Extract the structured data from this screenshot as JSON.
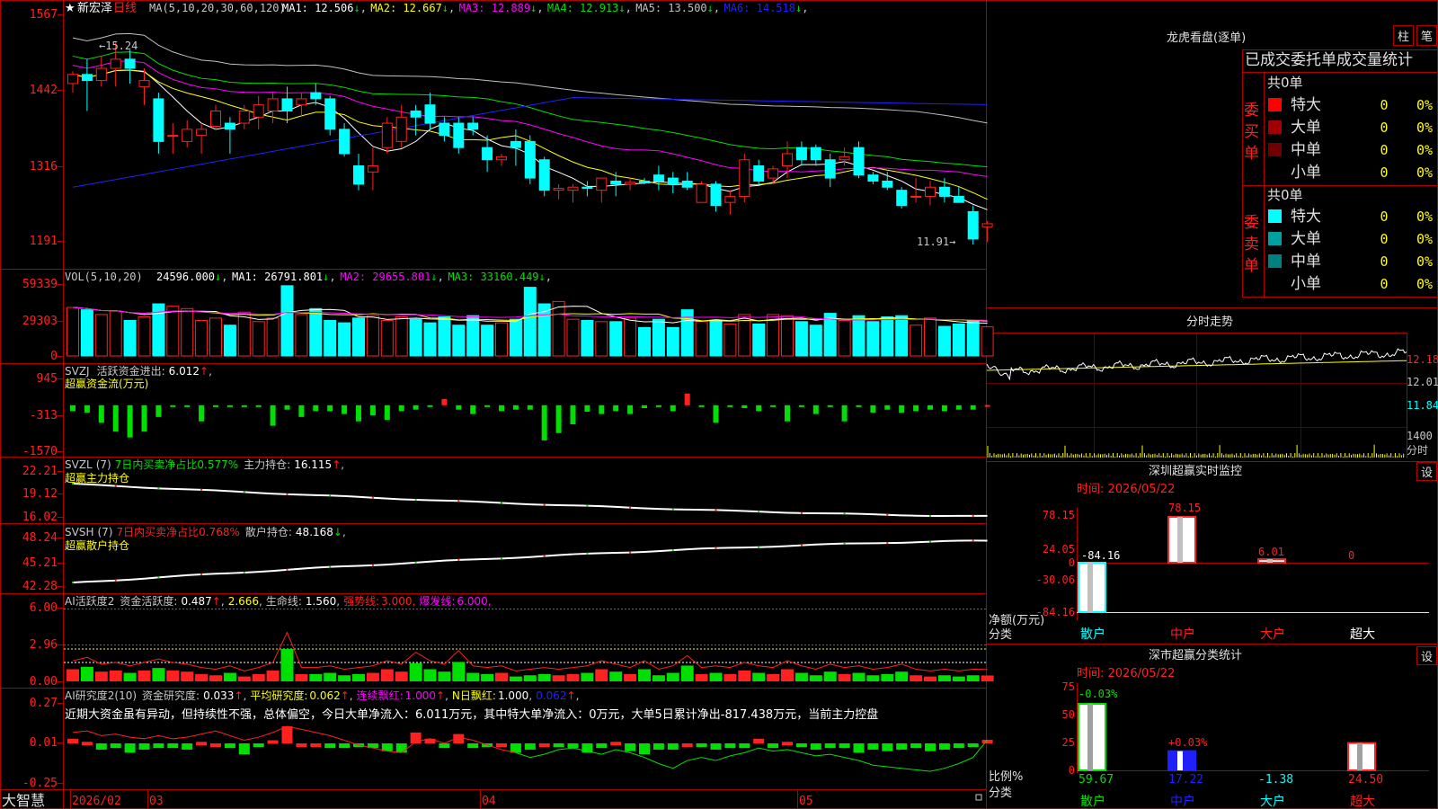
{
  "app": {
    "name": "大智慧"
  },
  "stock": {
    "star": "★",
    "name": "新宏泽",
    "period": "日线"
  },
  "kline": {
    "ma_title": "MA(5,10,20,30,60,120)",
    "ma": [
      {
        "label": "MA1:",
        "value": "12.506",
        "arrow": "↓",
        "color": "#ffffff"
      },
      {
        "label": "MA2:",
        "value": "12.667",
        "arrow": "↓",
        "color": "#ffff00"
      },
      {
        "label": "MA3:",
        "value": "12.889",
        "arrow": "↓",
        "color": "#ff00ff"
      },
      {
        "label": "MA4:",
        "value": "12.913",
        "arrow": "↓",
        "color": "#00e000"
      },
      {
        "label": "MA5:",
        "value": "13.500",
        "arrow": "↓",
        "color": "#c0c0c0"
      },
      {
        "label": "MA6:",
        "value": "14.518",
        "arrow": "↓",
        "color": "#2020ff"
      }
    ],
    "y_ticks": [
      "1567",
      "1442",
      "1316",
      "1191"
    ],
    "y_range": [
      11.91,
      15.67
    ],
    "high_label": "←15.24",
    "low_label": "11.91→",
    "candles": [
      [
        14.55,
        14.75,
        14.4,
        14.7
      ],
      [
        14.7,
        14.95,
        14.1,
        14.6
      ],
      [
        14.6,
        15.0,
        14.5,
        14.8
      ],
      [
        14.8,
        15.24,
        14.5,
        14.95
      ],
      [
        14.95,
        15.1,
        14.55,
        14.8
      ],
      [
        14.5,
        14.8,
        14.2,
        14.6
      ],
      [
        14.3,
        14.4,
        13.4,
        13.6
      ],
      [
        13.7,
        13.9,
        13.4,
        13.7
      ],
      [
        13.6,
        13.95,
        13.5,
        13.8
      ],
      [
        13.7,
        13.9,
        13.4,
        13.8
      ],
      [
        13.85,
        14.2,
        13.8,
        14.1
      ],
      [
        13.9,
        14.0,
        13.4,
        13.8
      ],
      [
        13.9,
        14.2,
        13.8,
        14.1
      ],
      [
        14.0,
        14.35,
        13.8,
        14.2
      ],
      [
        14.1,
        14.4,
        13.9,
        14.3
      ],
      [
        14.3,
        14.5,
        13.9,
        14.1
      ],
      [
        14.2,
        14.4,
        14.0,
        14.3
      ],
      [
        14.4,
        14.55,
        14.2,
        14.3
      ],
      [
        14.3,
        14.35,
        13.7,
        13.8
      ],
      [
        13.8,
        13.9,
        13.35,
        13.4
      ],
      [
        13.2,
        13.4,
        12.8,
        12.9
      ],
      [
        13.1,
        13.5,
        12.8,
        13.2
      ],
      [
        13.5,
        14.0,
        13.4,
        13.9
      ],
      [
        13.6,
        14.2,
        13.5,
        14.0
      ],
      [
        14.1,
        14.2,
        13.7,
        14.0
      ],
      [
        14.2,
        14.4,
        13.8,
        13.9
      ],
      [
        13.9,
        14.0,
        13.6,
        13.7
      ],
      [
        13.9,
        14.0,
        13.4,
        13.5
      ],
      [
        13.9,
        14.0,
        13.7,
        13.8
      ],
      [
        13.5,
        13.7,
        13.1,
        13.3
      ],
      [
        13.3,
        13.4,
        13.2,
        13.35
      ],
      [
        13.6,
        13.8,
        13.2,
        13.5
      ],
      [
        13.6,
        13.7,
        12.9,
        13.0
      ],
      [
        13.3,
        13.35,
        12.7,
        12.8
      ],
      [
        12.8,
        12.9,
        12.65,
        12.83
      ],
      [
        12.8,
        12.9,
        12.6,
        12.85
      ],
      [
        12.85,
        12.95,
        12.7,
        12.83
      ],
      [
        12.8,
        13.0,
        12.6,
        13.0
      ],
      [
        12.95,
        13.1,
        12.7,
        12.9
      ],
      [
        12.9,
        13.0,
        12.8,
        12.93
      ],
      [
        12.95,
        13.0,
        12.9,
        12.92
      ],
      [
        13.05,
        13.2,
        12.8,
        12.95
      ],
      [
        13.0,
        13.1,
        12.75,
        12.9
      ],
      [
        12.95,
        13.1,
        12.8,
        12.85
      ],
      [
        12.6,
        12.95,
        12.6,
        12.9
      ],
      [
        12.9,
        12.95,
        12.45,
        12.55
      ],
      [
        12.6,
        12.8,
        12.4,
        12.7
      ],
      [
        12.7,
        13.4,
        12.6,
        13.3
      ],
      [
        13.2,
        13.3,
        12.9,
        12.95
      ],
      [
        13.0,
        13.2,
        12.9,
        13.15
      ],
      [
        13.2,
        13.6,
        13.0,
        13.4
      ],
      [
        13.5,
        13.6,
        13.2,
        13.3
      ],
      [
        13.5,
        13.55,
        13.2,
        13.3
      ],
      [
        13.3,
        13.4,
        12.85,
        13.0
      ],
      [
        13.3,
        13.5,
        13.2,
        13.35
      ],
      [
        13.5,
        13.6,
        13.0,
        13.05
      ],
      [
        13.05,
        13.1,
        12.9,
        12.95
      ],
      [
        12.95,
        13.1,
        12.8,
        12.85
      ],
      [
        12.8,
        12.85,
        12.5,
        12.55
      ],
      [
        12.7,
        13.0,
        12.6,
        12.7
      ],
      [
        12.7,
        12.95,
        12.55,
        12.85
      ],
      [
        12.85,
        13.0,
        12.6,
        12.7
      ],
      [
        12.7,
        12.85,
        12.6,
        12.6
      ],
      [
        12.45,
        12.55,
        11.91,
        12.0
      ],
      [
        12.2,
        12.3,
        11.95,
        12.25
      ]
    ]
  },
  "volume": {
    "title": "VOL(5,10,20)",
    "value": "24596.000",
    "value_arrow": "↓",
    "ma": [
      {
        "label": "MA1:",
        "value": "26791.801",
        "arrow": "↓",
        "color": "#ffffff"
      },
      {
        "label": "MA2:",
        "value": "29655.801",
        "arrow": "↓",
        "color": "#ff00ff"
      },
      {
        "label": "MA3:",
        "value": "33160.449",
        "arrow": "↓",
        "color": "#00e000"
      }
    ],
    "y_ticks": [
      "59339",
      "29303",
      "0"
    ],
    "max": 63000,
    "values": [
      41000,
      39000,
      35000,
      38000,
      30000,
      33000,
      44000,
      42000,
      40000,
      30000,
      32000,
      26000,
      37000,
      29000,
      32000,
      59339,
      35000,
      40000,
      30000,
      28000,
      32000,
      34000,
      30000,
      33000,
      31000,
      28000,
      33000,
      26000,
      34000,
      26000,
      28000,
      31000,
      58000,
      44000,
      46000,
      31000,
      30000,
      29000,
      29000,
      32000,
      24000,
      31000,
      24000,
      39000,
      29000,
      30000,
      27000,
      35000,
      27000,
      35000,
      34000,
      29000,
      26000,
      36000,
      30000,
      34000,
      29000,
      33000,
      34000,
      26000,
      32000,
      25000,
      27000,
      30000,
      24596
    ]
  },
  "svzj": {
    "name": "SVZJ",
    "label": "活跃资金进出:",
    "value": "6.012",
    "arrow": "↑",
    "sub": "超赢资金流(万元)",
    "y_ticks": [
      "945",
      "-313",
      "-1570"
    ],
    "y_range": [
      -1570,
      945
    ],
    "values": [
      -200,
      -250,
      -600,
      -900,
      -1100,
      -900,
      -400,
      -20,
      -20,
      -550,
      -20,
      -10,
      -20,
      -20,
      -700,
      -150,
      -400,
      -200,
      -200,
      -300,
      -550,
      -350,
      -500,
      -200,
      -150,
      -10,
      210,
      -150,
      -300,
      -20,
      -200,
      -150,
      -150,
      -1200,
      -950,
      -650,
      -220,
      -300,
      -200,
      -300,
      -100,
      -60,
      -200,
      400,
      -20,
      -600,
      -20,
      -100,
      -200,
      -20,
      -550,
      -20,
      -300,
      -20,
      -550,
      -10,
      -250,
      -150,
      -250,
      -200,
      -150,
      -200,
      -150,
      -150,
      6
    ]
  },
  "svzl": {
    "name": "SVZL",
    "period": "(7)",
    "label": "7日内买卖净占比0.577%",
    "label2": "主力持仓:",
    "value": "16.115",
    "arrow": "↑",
    "sub": "超赢主力持仓",
    "y_ticks": [
      "22.21",
      "19.12",
      "16.02"
    ],
    "y_range": [
      16.02,
      22.21
    ],
    "start": 21.3,
    "end": 16.115
  },
  "svsh": {
    "name": "SVSH",
    "period": "(7)",
    "label": "7日内买卖净占比0.768%",
    "label2": "散户持仓:",
    "value": "48.168",
    "arrow": "↓",
    "sub": "超赢散户持仓",
    "y_ticks": [
      "48.24",
      "45.21",
      "42.28"
    ],
    "y_range": [
      42.28,
      48.24
    ],
    "start": 42.7,
    "end": 48.168
  },
  "ai1": {
    "name": "AI活跃度2",
    "label": "资金活跃度:",
    "value": "0.487",
    "arrow": "↑",
    "v2": "2.666",
    "label3": "生命线:",
    "v3": "1.560",
    "label4": "强势线:",
    "v4": "3.000",
    "label5": "爆发线:",
    "v5": "6.000",
    "y_ticks": [
      "6.00",
      "2.96",
      "0.00"
    ],
    "y_max": 6.0,
    "values": [
      1.0,
      1.2,
      0.8,
      0.9,
      0.7,
      0.9,
      1.1,
      0.9,
      0.8,
      0.6,
      0.5,
      0.7,
      0.4,
      0.6,
      0.9,
      2.666,
      0.6,
      0.6,
      0.7,
      0.5,
      0.6,
      0.7,
      1.0,
      0.8,
      1.5,
      1.0,
      0.8,
      1.6,
      0.7,
      0.6,
      0.7,
      0.4,
      0.5,
      0.6,
      0.5,
      0.6,
      0.7,
      1.0,
      0.8,
      0.6,
      1.0,
      0.5,
      0.7,
      1.3,
      0.6,
      0.7,
      0.6,
      0.9,
      0.7,
      0.6,
      1.0,
      0.7,
      0.5,
      0.8,
      0.6,
      0.7,
      0.5,
      0.6,
      0.8,
      0.5,
      0.4,
      0.5,
      0.4,
      0.5,
      0.487
    ]
  },
  "ai2": {
    "name": "AI研究度2(10)",
    "label": "资金研究度:",
    "value": "0.033",
    "arrow": "↑",
    "label2": "平均研究度:",
    "v2": "0.062",
    "label3": "连续飘红:",
    "v3": "1.000",
    "label4": "N日飘红:",
    "v4": "1.000",
    "v5": "0.062",
    "comment": "近期大资金虽有异动，但持续性不强，总体偏空，今日大单净流入：6.011万元，其中特大单净流入：0万元，大单5日累计净出-817.438万元，当前主力控盘",
    "y_ticks": [
      "0.27",
      "0.01",
      "-0.25"
    ],
    "y_range": [
      -0.25,
      0.27
    ],
    "values": [
      0.04,
      0.02,
      -0.03,
      -0.02,
      -0.05,
      -0.03,
      -0.02,
      -0.02,
      -0.03,
      0.02,
      0.01,
      -0.02,
      -0.06,
      -0.01,
      0.03,
      0.12,
      0.01,
      0.0,
      -0.02,
      -0.02,
      -0.01,
      -0.02,
      -0.04,
      -0.05,
      0.08,
      0.04,
      -0.02,
      0.07,
      -0.02,
      -0.01,
      0.01,
      -0.05,
      -0.03,
      0.0,
      -0.01,
      -0.02,
      -0.05,
      -0.02,
      0.02,
      -0.04,
      -0.06,
      -0.03,
      -0.03,
      0.01,
      -0.01,
      -0.03,
      -0.02,
      -0.02,
      0.04,
      -0.02,
      0.02,
      -0.01,
      -0.03,
      -0.02,
      -0.02,
      -0.05,
      -0.03,
      -0.04,
      -0.03,
      -0.02,
      -0.04,
      -0.03,
      -0.02,
      -0.01,
      0.033
    ],
    "line": [
      0.08,
      0.09,
      0.06,
      0.07,
      0.05,
      0.04,
      0.06,
      0.04,
      0.05,
      0.07,
      0.09,
      0.06,
      0.03,
      0.05,
      0.08,
      0.12,
      0.1,
      0.08,
      0.06,
      0.03,
      0.0,
      -0.02,
      -0.04,
      -0.05,
      0.02,
      0.04,
      0.01,
      0.05,
      0.03,
      0.0,
      -0.03,
      -0.05,
      -0.08,
      -0.06,
      -0.03,
      -0.02,
      -0.04,
      -0.06,
      -0.03,
      -0.05,
      -0.08,
      -0.12,
      -0.15,
      -0.1,
      -0.08,
      -0.1,
      -0.07,
      -0.05,
      -0.02,
      -0.04,
      -0.03,
      -0.05,
      -0.07,
      -0.06,
      -0.08,
      -0.1,
      -0.13,
      -0.14,
      -0.15,
      -0.16,
      -0.17,
      -0.15,
      -0.12,
      -0.08,
      0.033
    ]
  },
  "dates": [
    "2026/02",
    "03",
    "04",
    "05"
  ],
  "right": {
    "lh_title": "龙虎看盘(逐单)",
    "btn1": "柱",
    "btn2": "笔",
    "table_title": "已成交委托单成交量统计",
    "buy_side": "委买单",
    "sell_side": "委卖单",
    "buy_total": "共0单",
    "sell_total": "共0单",
    "buy_rows": [
      {
        "label": "特大",
        "count": "0",
        "pct": "0%",
        "color": "#ff0000"
      },
      {
        "label": "大单",
        "count": "0",
        "pct": "0%",
        "color": "#a00000"
      },
      {
        "label": "中单",
        "count": "0",
        "pct": "0%",
        "color": "#700000"
      },
      {
        "label": "小单",
        "count": "0",
        "pct": "0%",
        "color": "#000000"
      }
    ],
    "sell_rows": [
      {
        "label": "特大",
        "count": "0",
        "pct": "0%",
        "color": "#00ffff"
      },
      {
        "label": "大单",
        "count": "0",
        "pct": "0%",
        "color": "#00a0a0"
      },
      {
        "label": "中单",
        "count": "0",
        "pct": "0%",
        "color": "#008080"
      },
      {
        "label": "小单",
        "count": "0",
        "pct": "0%",
        "color": "#000000"
      }
    ],
    "intraday_title": "分时走势",
    "intraday_ticks": [
      "12.18",
      "12.01",
      "11.84",
      "1400",
      "分时"
    ],
    "sz_title": "深圳超赢实时监控",
    "sz_btn": "设",
    "sz_time": "时间: 2026/05/22",
    "sz_ticks": [
      "78.15",
      "24.05",
      "0",
      "-30.06",
      "-84.16"
    ],
    "sz_unit": "净额(万元)",
    "sz_unit2": "分类",
    "sz_categories": [
      "散户",
      "中户",
      "大户",
      "超大"
    ],
    "sz_values": [
      -84.16,
      78.15,
      6.01,
      0
    ],
    "sz_value_labels": [
      "-84.16",
      "78.15",
      "6.01",
      "0"
    ],
    "cls_title": "深市超赢分类统计",
    "cls_btn": "设",
    "cls_time": "时间: 2026/05/22",
    "cls_ticks": [
      "75",
      "50",
      "25",
      "0"
    ],
    "cls_unit": "比例%",
    "cls_unit2": "分类",
    "cls_categories": [
      "散户",
      "中户",
      "大户",
      "超大"
    ],
    "cls_values": [
      59.67,
      17.22,
      -1.38,
      24.5
    ],
    "cls_value_labels": [
      "59.67",
      "17.22",
      "-1.38",
      "24.50"
    ],
    "cls_top_labels": [
      "-0.03%",
      "+0.03%"
    ]
  },
  "colors": {
    "up": "#ff2020",
    "down": "#00ffff",
    "border": "#b00000",
    "green": "#00e000",
    "yellow": "#ffff00",
    "magenta": "#ff00ff"
  }
}
